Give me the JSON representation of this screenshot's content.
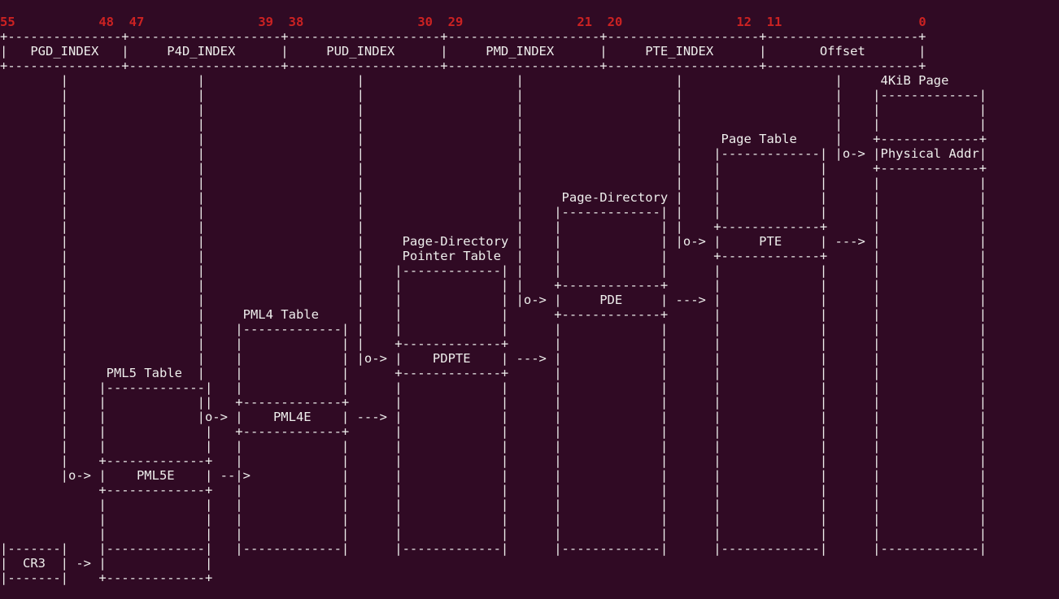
{
  "bits": {
    "b55": "55",
    "b48": "48",
    "b47": "47",
    "b39": "39",
    "b38": "38",
    "b30": "30",
    "b29": "29",
    "b21": "21",
    "b20": "20",
    "b12": "12",
    "b11": "11",
    "b0": "0"
  },
  "fields": {
    "pgd": "PGD_INDEX",
    "p4d": "P4D_INDEX",
    "pud": "PUD_INDEX",
    "pmd": "PMD_INDEX",
    "pte": "PTE_INDEX",
    "off": "Offset"
  },
  "tables": {
    "page4k": "4KiB Page",
    "phys": "Physical Addr",
    "pageTbl": "Page Table",
    "pteE": "PTE",
    "pd": "Page-Directory",
    "pde": "PDE",
    "pdpt1": "Page-Directory",
    "pdpt2": "Pointer Table",
    "pdpte": "PDPTE",
    "pml4": "PML4 Table",
    "pml4e": "PML4E",
    "pml5": "PML5 Table",
    "pml5e": "PML5E",
    "cr3": "CR3"
  },
  "sym": {
    "arrow_s": "--->",
    "arrow_m": "------>",
    "arrow_l": "-------->",
    "ptr": "o->",
    "ptr_s": "->"
  }
}
